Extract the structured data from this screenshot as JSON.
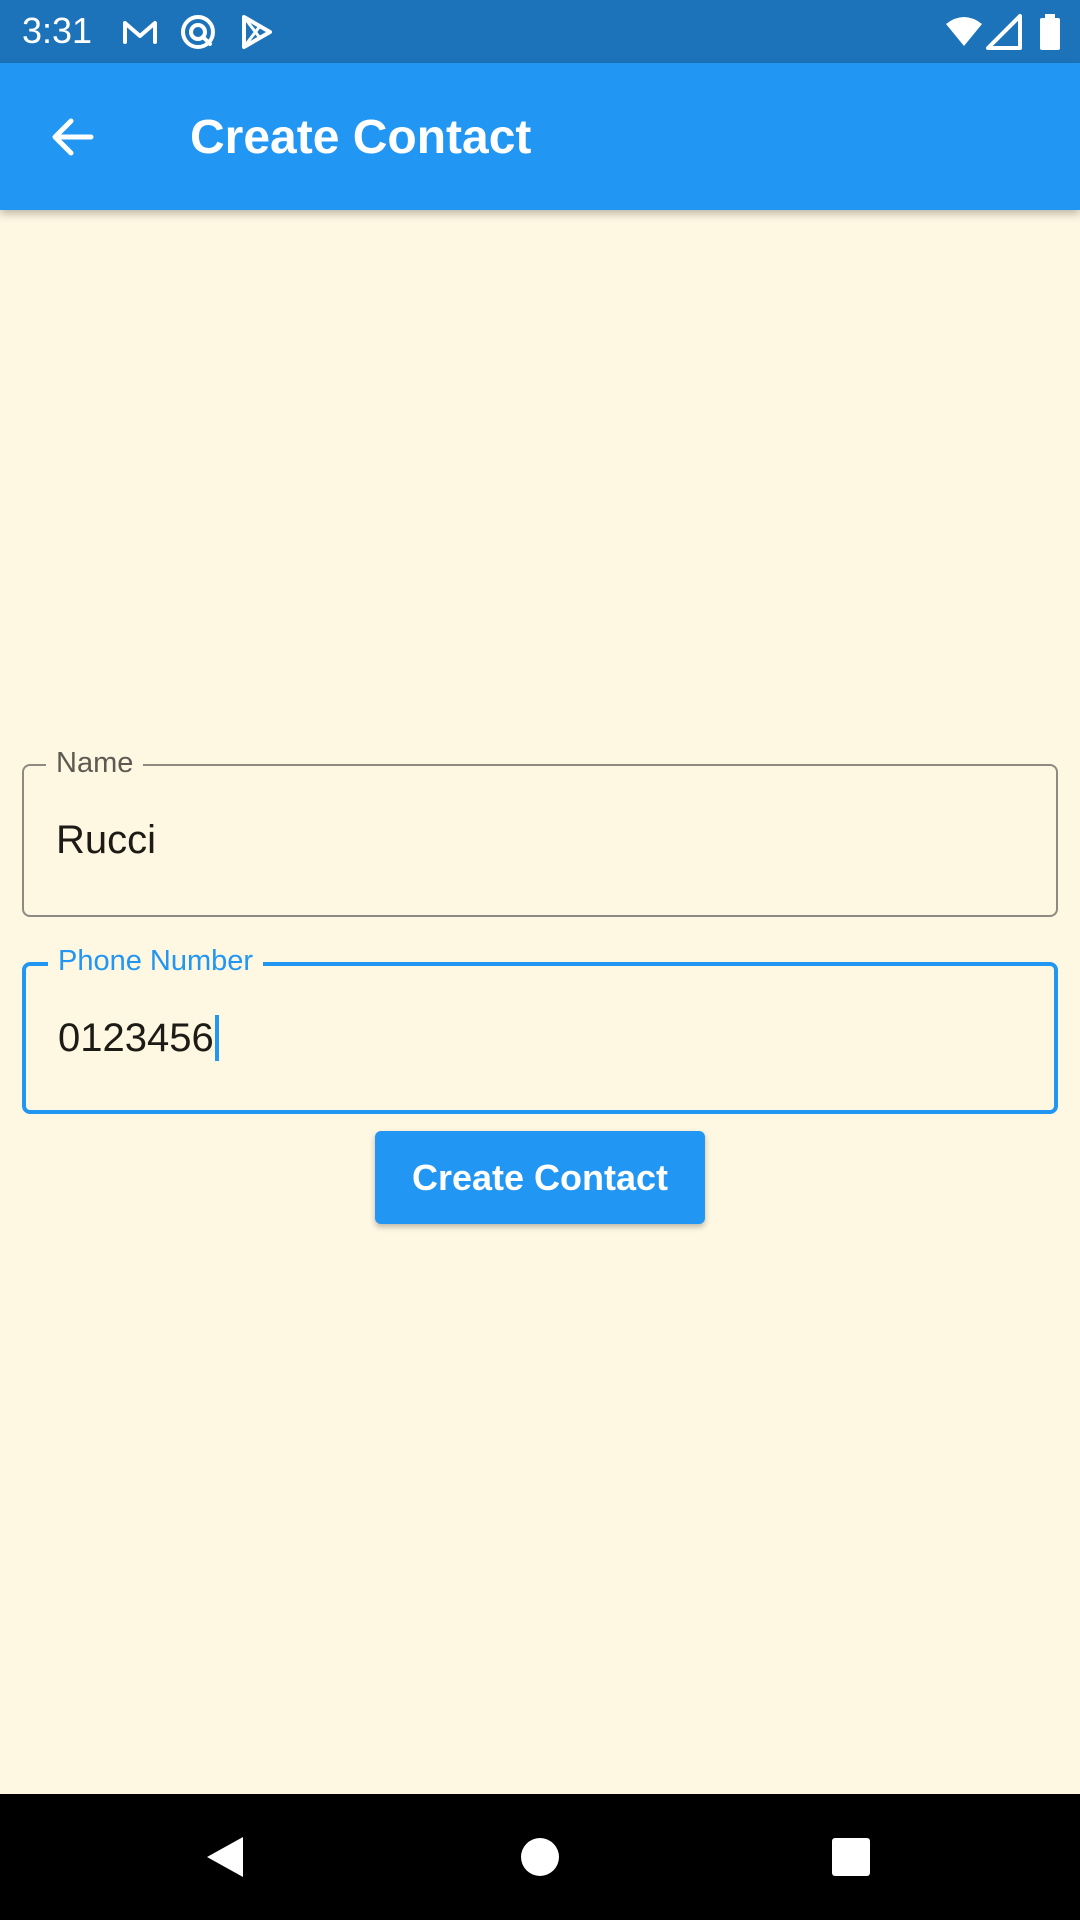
{
  "status_bar": {
    "time": "3:31",
    "left_icons": [
      "gmail-icon",
      "sync-icon",
      "play-store-icon"
    ],
    "right_icons": [
      "wifi-icon",
      "signal-icon",
      "battery-icon"
    ],
    "background": "#1C73B9"
  },
  "app_bar": {
    "title": "Create Contact",
    "back_icon": "arrow-back-icon",
    "background": "#2196F3"
  },
  "form": {
    "name_field": {
      "label": "Name",
      "value": "Rucci"
    },
    "phone_field": {
      "label": "Phone Number",
      "value": "0123456",
      "focused": true
    },
    "submit_label": "Create Contact"
  },
  "nav_bar": {
    "buttons": [
      "back-triangle-icon",
      "home-circle-icon",
      "recents-square-icon"
    ]
  },
  "colors": {
    "accent": "#2196F3",
    "page_background": "#FEF7E2",
    "text": "#1D1B16"
  }
}
